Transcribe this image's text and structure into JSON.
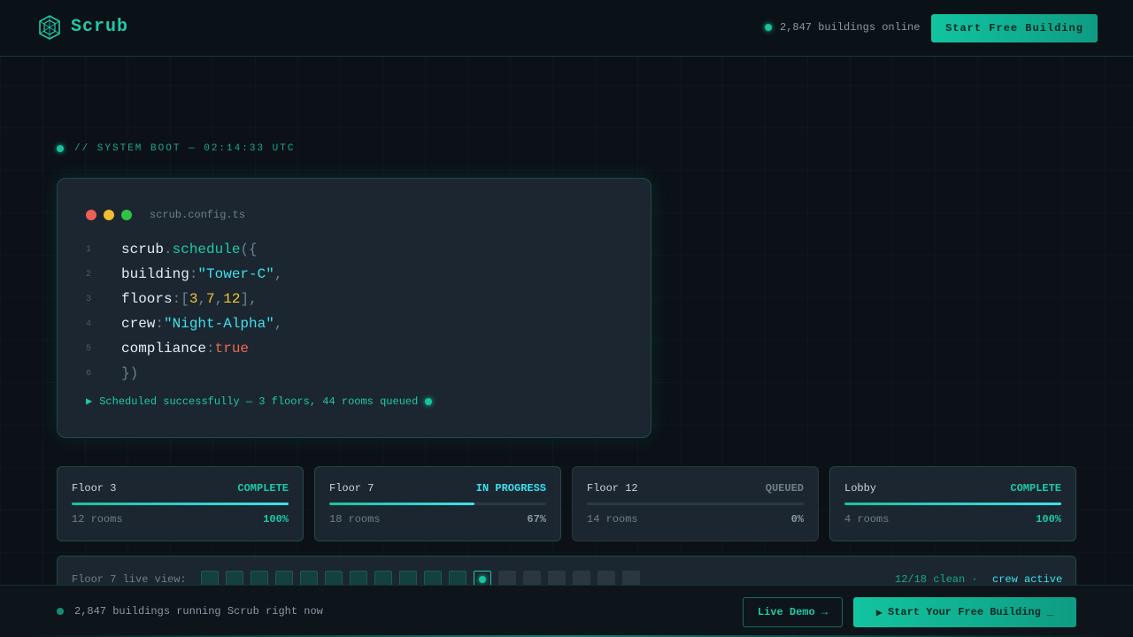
{
  "header": {
    "brand": "Scrub",
    "online_text": "2,847 buildings online",
    "cta_label": "Start Free Building"
  },
  "hero": {
    "boot_text": "// SYSTEM BOOT — 02:14:33 UTC"
  },
  "code": {
    "filename": "scrub.config.ts",
    "line_numbers": [
      "1",
      "2",
      "3",
      "4",
      "5",
      "6"
    ],
    "status_text": "Scheduled successfully — 3 floors, 44 rooms queued",
    "line1": {
      "obj": "scrub",
      "dot": ".",
      "fn": "schedule",
      "open": "({"
    },
    "line2": {
      "key": "building",
      "colon": ":",
      "value": "\"Tower-C\"",
      "comma": ","
    },
    "line3": {
      "key": "floors",
      "colon": ":",
      "open": "[",
      "n1": "3",
      "c1": ",",
      "n2": "7",
      "c2": ",",
      "n3": "12",
      "close": "],"
    },
    "line4": {
      "key": "crew",
      "colon": ":",
      "value": "\"Night-Alpha\"",
      "comma": ","
    },
    "line5": {
      "key": "compliance",
      "colon": ":",
      "value": "true"
    },
    "line6": {
      "close": "})"
    }
  },
  "floors": [
    {
      "name": "Floor 3",
      "status": "COMPLETE",
      "rooms": "12 rooms",
      "pct": "100%",
      "progress": 1.0
    },
    {
      "name": "Floor 7",
      "status": "IN PROGRESS",
      "rooms": "18 rooms",
      "pct": "67%",
      "progress": 0.67
    },
    {
      "name": "Floor 12",
      "status": "QUEUED",
      "rooms": "14 rooms",
      "pct": "0%",
      "progress": 0.0
    },
    {
      "name": "Lobby",
      "status": "COMPLETE",
      "rooms": "4 rooms",
      "pct": "100%",
      "progress": 1.0
    }
  ],
  "live_view": {
    "label": "Floor 7 live view:",
    "count_text": "12/18 clean ·",
    "crew_text": "crew active",
    "rooms_total": 18,
    "rooms_clean": 11,
    "active_index": 11
  },
  "footer": {
    "text": "2,847 buildings running Scrub right now",
    "demo_label": "Live Demo →",
    "cta_label": "Start Your Free Building _",
    "cta_icon": "play-icon"
  },
  "colors": {
    "accent": "#1fc9a8",
    "cyan": "#3ee0ee",
    "background": "#0b1117"
  }
}
